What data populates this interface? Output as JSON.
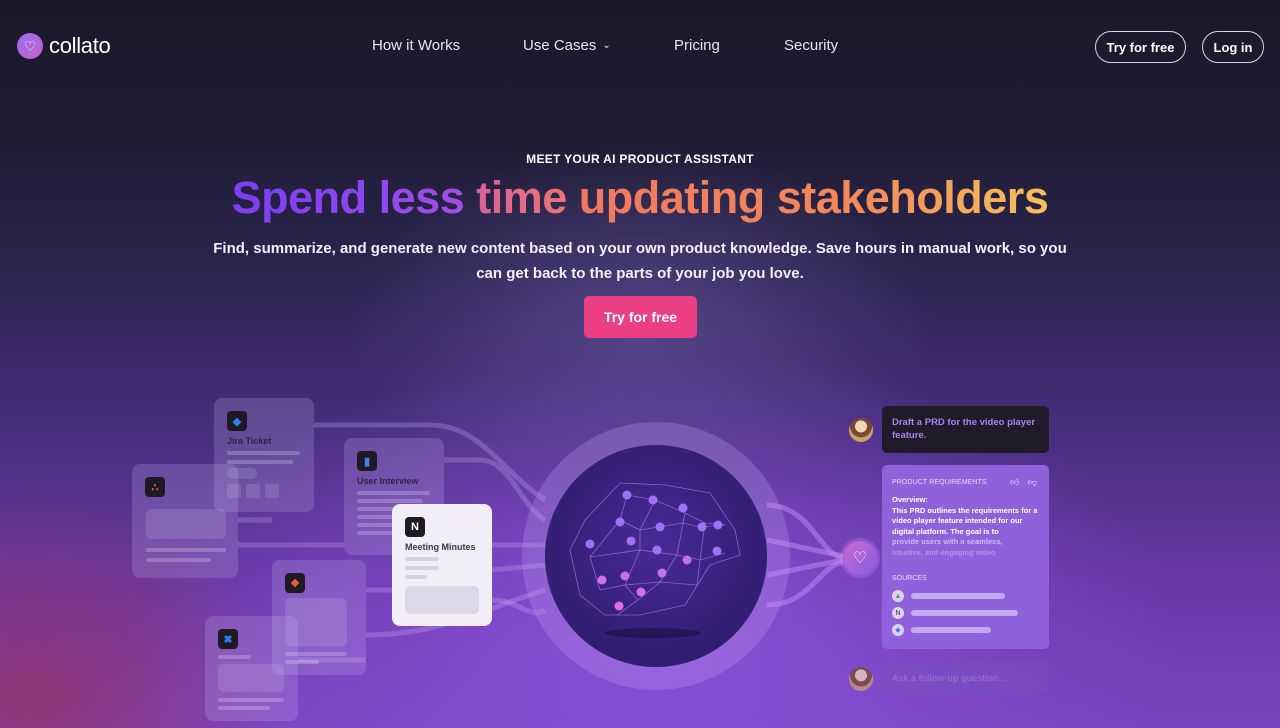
{
  "brand": {
    "name": "collato",
    "accent": "#ea3f85"
  },
  "nav": {
    "links": [
      {
        "label": "How it Works"
      },
      {
        "label": "Use Cases",
        "has_dropdown": true
      },
      {
        "label": "Pricing"
      },
      {
        "label": "Security"
      }
    ],
    "try_label": "Try for free",
    "login_label": "Log in"
  },
  "hero": {
    "eyebrow": "MEET YOUR AI PRODUCT ASSISTANT",
    "headline_parts": [
      "Spend less ",
      "time ",
      "updating stakeholders"
    ],
    "subtitle": "Find, summarize, and generate new content based on your own product knowledge. Save hours in manual work, so you can get back to the parts of your job you love.",
    "cta_label": "Try for free"
  },
  "illustration": {
    "cards": [
      {
        "title": "Jira Ticket",
        "icon": "jira-icon"
      },
      {
        "title": "User Interview",
        "icon": "google-docs-icon"
      },
      {
        "title": "Meeting Minutes",
        "icon": "notion-icon"
      },
      {
        "title": "",
        "icon": "asana-icon"
      },
      {
        "title": "",
        "icon": "figma-icon"
      },
      {
        "title": "",
        "icon": "confluence-icon"
      }
    ],
    "chat": {
      "question": "Draft a PRD for the video player feature.",
      "response_header": "PRODUCT REQUIREMENTS",
      "overview_label": "Overview:",
      "overview_text": "This PRD outlines the requirements for a video player feature intended for our digital platform. The goal is to",
      "overview_fade1": "provide users with a seamless,",
      "overview_fade2": "intuitive, and engaging video",
      "sources_label": "SOURCES",
      "sources": [
        "google-drive-icon",
        "notion-icon",
        "jira-icon"
      ],
      "input_placeholder": "Ask a follow-up question..."
    }
  }
}
